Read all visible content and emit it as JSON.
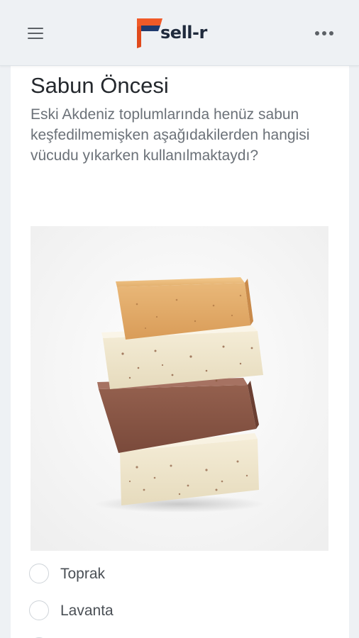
{
  "header": {
    "logo_text": "sell-r",
    "menu_icon": "hamburger-menu-icon",
    "more_icon": "more-horizontal-icon"
  },
  "colors": {
    "brand_orange": "#f05a28",
    "brand_navy": "#1f3a6e",
    "background": "#eef1f4"
  },
  "question": {
    "title": "Sabun Öncesi",
    "text": "Eski Akdeniz toplumlarında henüz sabun keşfedilmemişken aşağıdakilerden hangisi vücudu yıkarken kullanılmaktaydı?",
    "image_alt": "Stacked handmade soap bars"
  },
  "options": [
    {
      "label": "Toprak",
      "selected": false
    },
    {
      "label": "Lavanta",
      "selected": false
    }
  ]
}
